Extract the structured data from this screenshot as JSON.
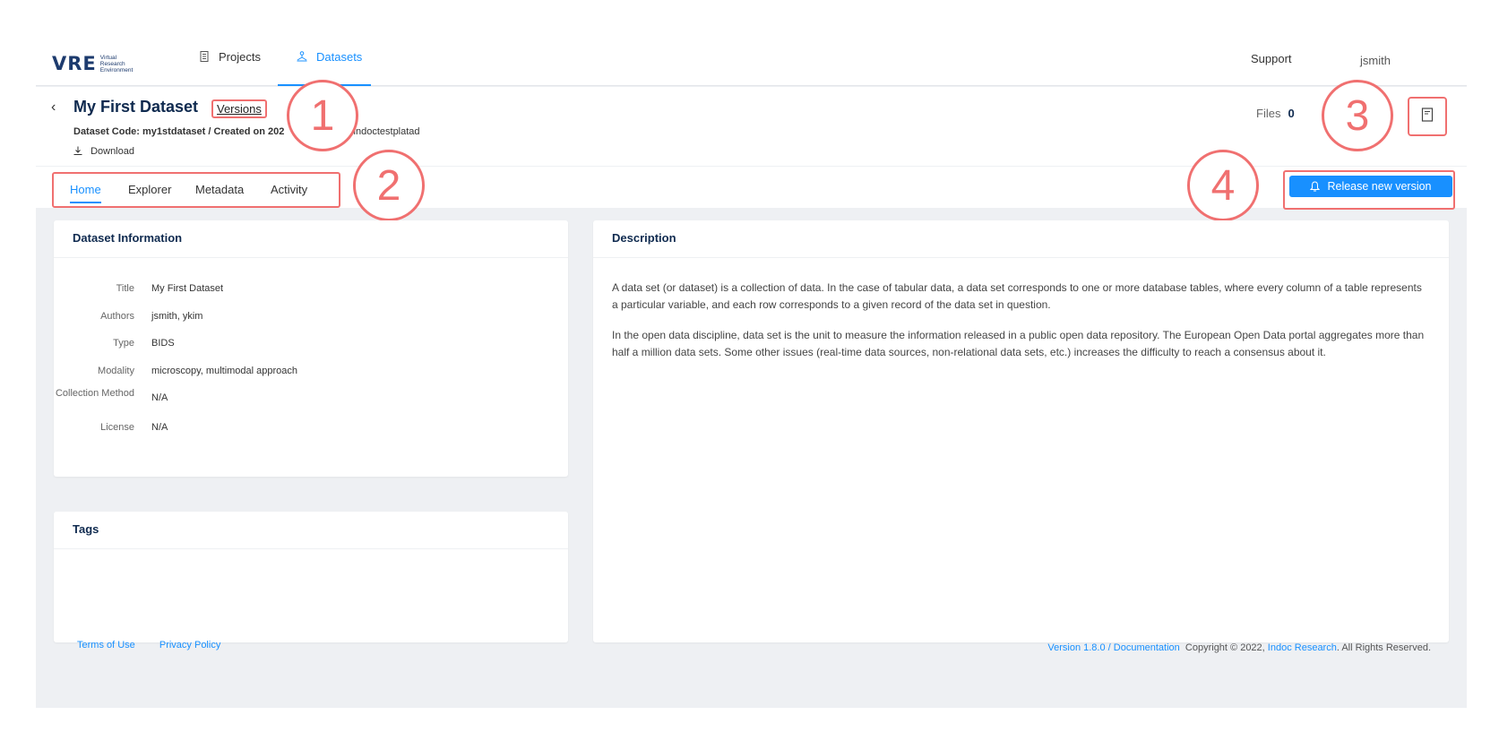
{
  "header": {
    "logo_text": "VRE",
    "logo_sub": [
      "Virtual",
      "Research",
      "Environment"
    ],
    "nav": [
      {
        "label": "Projects",
        "icon": "document-icon",
        "active": false
      },
      {
        "label": "Datasets",
        "icon": "dataset-icon",
        "active": true
      }
    ],
    "support": "Support",
    "user": "jsmith"
  },
  "dataset": {
    "title": "My First Dataset",
    "versions_label": "Versions",
    "code_label": "Dataset Code: my1stdataset / Created on 202",
    "meta_suffix": "mindoctestplatad",
    "download_label": "Download",
    "files_label": "Files",
    "files_count": "0"
  },
  "tabs": [
    "Home",
    "Explorer",
    "Metadata",
    "Activity"
  ],
  "active_tab": "Home",
  "release_button": "Release new version",
  "annotations": [
    "1",
    "2",
    "3",
    "4"
  ],
  "info": {
    "heading": "Dataset Information",
    "rows": [
      {
        "label": "Title",
        "value": "My First Dataset"
      },
      {
        "label": "Authors",
        "value": "jsmith, ykim"
      },
      {
        "label": "Type",
        "value": "BIDS"
      },
      {
        "label": "Modality",
        "value": "microscopy, multimodal approach"
      },
      {
        "label": "Collection Method",
        "value": "N/A"
      },
      {
        "label": "License",
        "value": "N/A"
      }
    ]
  },
  "tags": {
    "heading": "Tags"
  },
  "description": {
    "heading": "Description",
    "paragraphs": [
      "A data set (or dataset) is a collection of data. In the case of tabular data, a data set corresponds to one or more database tables, where every column of a table represents a particular variable, and each row corresponds to a given record of the data set in question.",
      "In the open data discipline, data set is the unit to measure the information released in a public open data repository. The European Open Data portal aggregates more than half a million data sets. Some other issues (real-time data sources, non-relational data sets, etc.) increases the difficulty to reach a consensus about it."
    ]
  },
  "footer": {
    "terms": "Terms of Use",
    "privacy": "Privacy Policy",
    "version": "Version 1.8.0",
    "separator": " / ",
    "documentation": "Documentation",
    "copyright": "Copyright © 2022,",
    "company": "Indoc Research",
    "rights": ". All Rights Reserved."
  },
  "colors": {
    "accent": "#1890ff",
    "annotation": "#f07070",
    "title": "#0f2a4f"
  }
}
